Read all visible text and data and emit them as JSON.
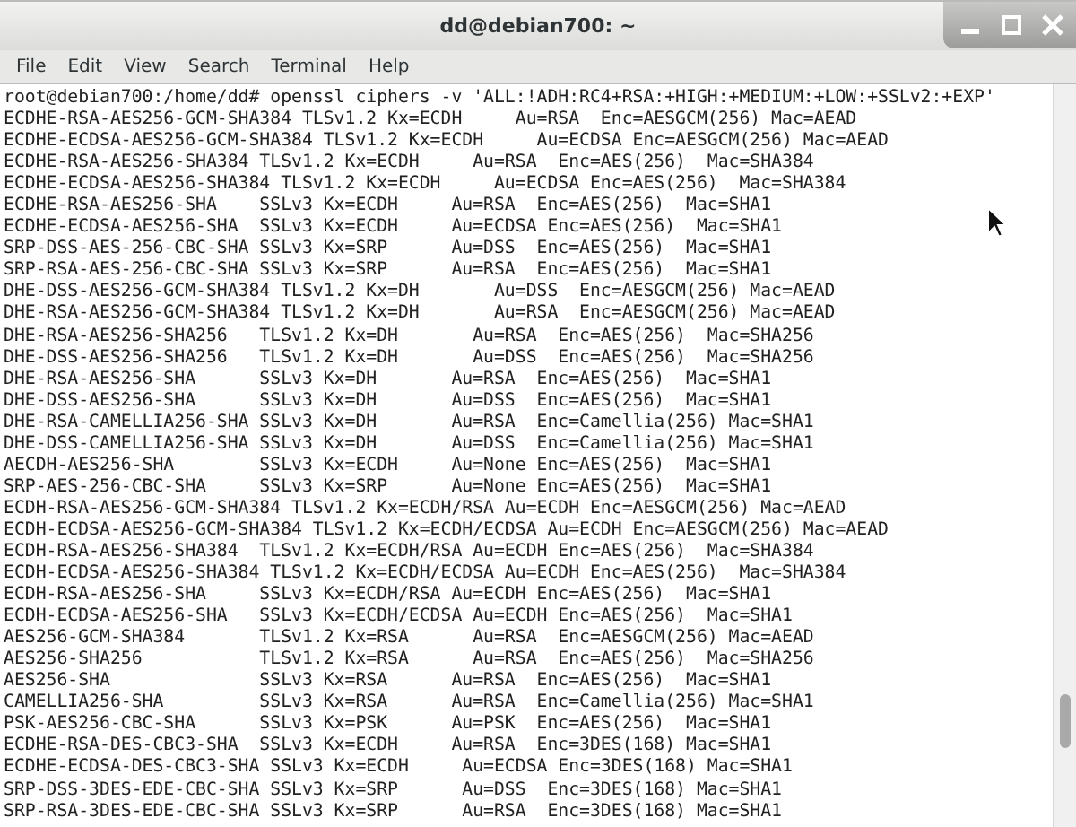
{
  "window": {
    "title": "dd@debian700: ~"
  },
  "menu": [
    "File",
    "Edit",
    "View",
    "Search",
    "Terminal",
    "Help"
  ],
  "terminal": {
    "lines": [
      "root@debian700:/home/dd# openssl ciphers -v 'ALL:!ADH:RC4+RSA:+HIGH:+MEDIUM:+LOW:+SSLv2:+EXP'",
      "ECDHE-RSA-AES256-GCM-SHA384 TLSv1.2 Kx=ECDH     Au=RSA  Enc=AESGCM(256) Mac=AEAD",
      "ECDHE-ECDSA-AES256-GCM-SHA384 TLSv1.2 Kx=ECDH     Au=ECDSA Enc=AESGCM(256) Mac=AEAD",
      "ECDHE-RSA-AES256-SHA384 TLSv1.2 Kx=ECDH     Au=RSA  Enc=AES(256)  Mac=SHA384",
      "ECDHE-ECDSA-AES256-SHA384 TLSv1.2 Kx=ECDH     Au=ECDSA Enc=AES(256)  Mac=SHA384",
      "ECDHE-RSA-AES256-SHA    SSLv3 Kx=ECDH     Au=RSA  Enc=AES(256)  Mac=SHA1",
      "ECDHE-ECDSA-AES256-SHA  SSLv3 Kx=ECDH     Au=ECDSA Enc=AES(256)  Mac=SHA1",
      "SRP-DSS-AES-256-CBC-SHA SSLv3 Kx=SRP      Au=DSS  Enc=AES(256)  Mac=SHA1",
      "SRP-RSA-AES-256-CBC-SHA SSLv3 Kx=SRP      Au=RSA  Enc=AES(256)  Mac=SHA1",
      "DHE-DSS-AES256-GCM-SHA384 TLSv1.2 Kx=DH       Au=DSS  Enc=AESGCM(256) Mac=AEAD",
      "DHE-RSA-AES256-GCM-SHA384 TLSv1.2 Kx=DH       Au=RSA  Enc=AESGCM(256) Mac=AEAD",
      "DHE-RSA-AES256-SHA256   TLSv1.2 Kx=DH       Au=RSA  Enc=AES(256)  Mac=SHA256",
      "DHE-DSS-AES256-SHA256   TLSv1.2 Kx=DH       Au=DSS  Enc=AES(256)  Mac=SHA256",
      "DHE-RSA-AES256-SHA      SSLv3 Kx=DH       Au=RSA  Enc=AES(256)  Mac=SHA1",
      "DHE-DSS-AES256-SHA      SSLv3 Kx=DH       Au=DSS  Enc=AES(256)  Mac=SHA1",
      "DHE-RSA-CAMELLIA256-SHA SSLv3 Kx=DH       Au=RSA  Enc=Camellia(256) Mac=SHA1",
      "DHE-DSS-CAMELLIA256-SHA SSLv3 Kx=DH       Au=DSS  Enc=Camellia(256) Mac=SHA1",
      "AECDH-AES256-SHA        SSLv3 Kx=ECDH     Au=None Enc=AES(256)  Mac=SHA1",
      "SRP-AES-256-CBC-SHA     SSLv3 Kx=SRP      Au=None Enc=AES(256)  Mac=SHA1",
      "ECDH-RSA-AES256-GCM-SHA384 TLSv1.2 Kx=ECDH/RSA Au=ECDH Enc=AESGCM(256) Mac=AEAD",
      "ECDH-ECDSA-AES256-GCM-SHA384 TLSv1.2 Kx=ECDH/ECDSA Au=ECDH Enc=AESGCM(256) Mac=AEAD",
      "ECDH-RSA-AES256-SHA384  TLSv1.2 Kx=ECDH/RSA Au=ECDH Enc=AES(256)  Mac=SHA384",
      "ECDH-ECDSA-AES256-SHA384 TLSv1.2 Kx=ECDH/ECDSA Au=ECDH Enc=AES(256)  Mac=SHA384",
      "ECDH-RSA-AES256-SHA     SSLv3 Kx=ECDH/RSA Au=ECDH Enc=AES(256)  Mac=SHA1",
      "ECDH-ECDSA-AES256-SHA   SSLv3 Kx=ECDH/ECDSA Au=ECDH Enc=AES(256)  Mac=SHA1",
      "AES256-GCM-SHA384       TLSv1.2 Kx=RSA      Au=RSA  Enc=AESGCM(256) Mac=AEAD",
      "AES256-SHA256           TLSv1.2 Kx=RSA      Au=RSA  Enc=AES(256)  Mac=SHA256",
      "AES256-SHA              SSLv3 Kx=RSA      Au=RSA  Enc=AES(256)  Mac=SHA1",
      "CAMELLIA256-SHA         SSLv3 Kx=RSA      Au=RSA  Enc=Camellia(256) Mac=SHA1",
      "PSK-AES256-CBC-SHA      SSLv3 Kx=PSK      Au=PSK  Enc=AES(256)  Mac=SHA1",
      "ECDHE-RSA-DES-CBC3-SHA  SSLv3 Kx=ECDH     Au=RSA  Enc=3DES(168) Mac=SHA1",
      "ECDHE-ECDSA-DES-CBC3-SHA SSLv3 Kx=ECDH     Au=ECDSA Enc=3DES(168) Mac=SHA1",
      "SRP-DSS-3DES-EDE-CBC-SHA SSLv3 Kx=SRP      Au=DSS  Enc=3DES(168) Mac=SHA1",
      "SRP-RSA-3DES-EDE-CBC-SHA SSLv3 Kx=SRP      Au=RSA  Enc=3DES(168) Mac=SHA1"
    ]
  }
}
